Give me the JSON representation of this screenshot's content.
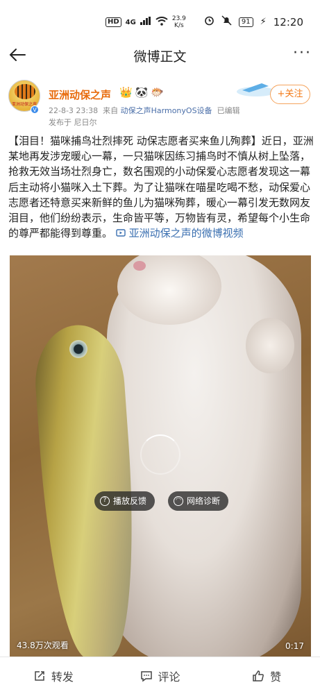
{
  "status_bar": {
    "hd_badge": "HD",
    "network": "4G",
    "speed_value": "23.9",
    "speed_unit": "K/s",
    "battery": "91",
    "time": "12:20"
  },
  "nav": {
    "title": "微博正文",
    "more": "···"
  },
  "author": {
    "name": "亚洲动保之声",
    "avatar_text": "亚洲动保之声",
    "verified_badge": "V",
    "emoji": [
      "👑",
      "🐼",
      "🐡"
    ],
    "date": "22-8-3 23:38",
    "from_label": "来自",
    "source": "动保之声HarmonyOS设备",
    "edited": "已编辑",
    "location": "发布于 尼日尔",
    "follow_label": "+关注"
  },
  "post": {
    "text": "【泪目！猫咪捕鸟壮烈摔死 动保志愿者买来鱼儿殉葬】近日，亚洲某地再发涉宠暖心一幕，一只猫咪因练习捕鸟时不慎从树上坠落，抢救无效当场壮烈身亡，数名围观的小动保爱心志愿者发现这一幕后主动将小猫咪入土下葬。为了让猫咪在喵星吃喝不愁，动保爱心志愿者还特意买来新鲜的鱼儿为猫咪殉葬，暖心一幕引发无数网友泪目，他们纷纷表示，生命皆平等，万物皆有灵，希望每个小生命的尊严都能得到尊重。",
    "video_link": "亚洲动保之声的微博视频"
  },
  "video": {
    "feedback_label": "播放反馈",
    "diagnose_label": "网络诊断",
    "views": "43.8万次观看",
    "duration": "0:17"
  },
  "actions": {
    "repost": "转发",
    "comment": "评论",
    "like": "赞"
  }
}
